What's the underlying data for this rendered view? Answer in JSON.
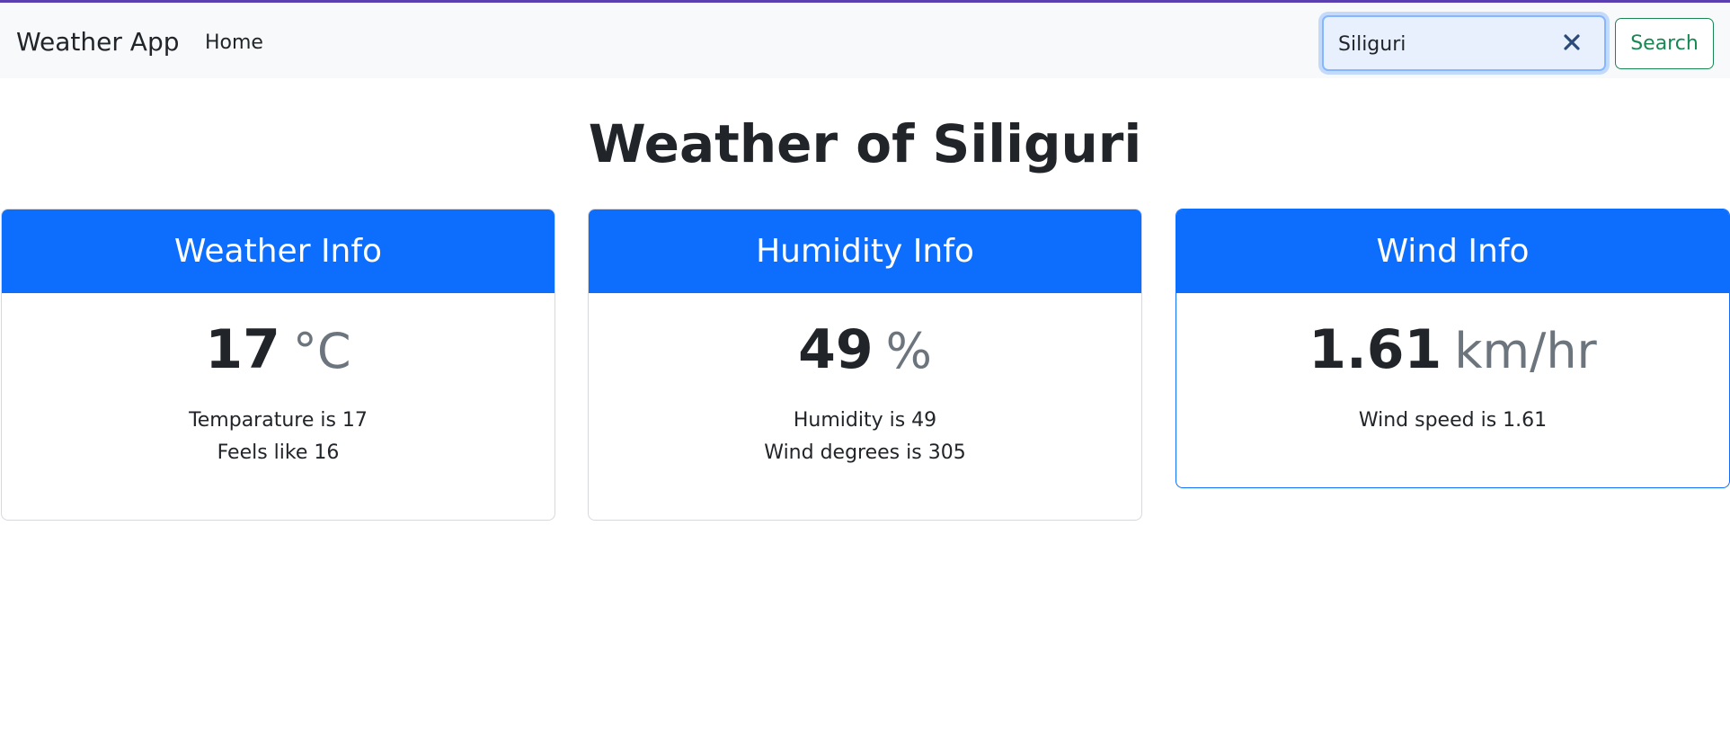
{
  "navbar": {
    "brand": "Weather App",
    "links": [
      {
        "label": "Home"
      }
    ],
    "search": {
      "value": "Siliguri",
      "placeholder": ""
    },
    "search_button_label": "Search"
  },
  "main": {
    "title": "Weather of Siliguri",
    "cards": [
      {
        "header": "Weather Info",
        "value": "17",
        "unit": "°C",
        "details": [
          "Temparature is 17",
          "Feels like 16"
        ]
      },
      {
        "header": "Humidity Info",
        "value": "49",
        "unit": "%",
        "details": [
          "Humidity is 49",
          "Wind degrees is 305"
        ]
      },
      {
        "header": "Wind Info",
        "value": "1.61",
        "unit": "km/hr",
        "details": [
          "Wind speed is 1.61"
        ]
      }
    ]
  },
  "icons": {
    "clear": "close-icon"
  },
  "colors": {
    "primary": "#0d6efd",
    "success": "#198754",
    "navbar_bg": "#f8f9fa",
    "top_accent": "#5b3fb0",
    "muted": "#6c757d"
  }
}
